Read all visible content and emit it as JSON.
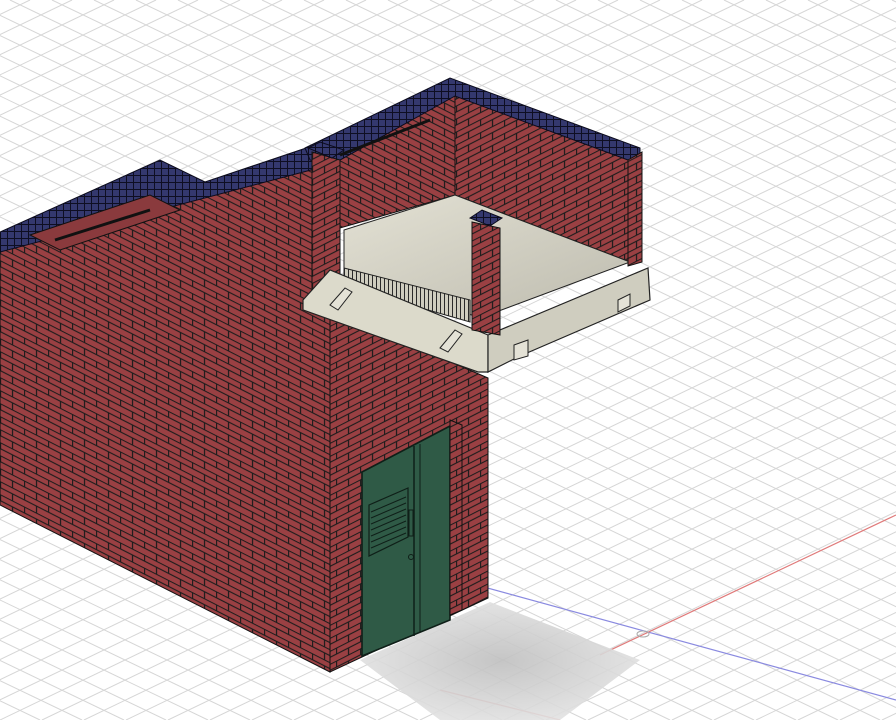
{
  "viewport": {
    "background": "#ffffff",
    "grid_color": "#d6d6d6",
    "axis_x_color": "#e07a7a",
    "axis_y_color": "#8a8ae0"
  },
  "model": {
    "brick_color": "#9a4043",
    "mortar_color": "#1c1c1c",
    "coping_color": "#34386e",
    "slab_color": "#d6d4c6",
    "door_color": "#2f5a46",
    "shadow_color": "#cfcfcf"
  }
}
